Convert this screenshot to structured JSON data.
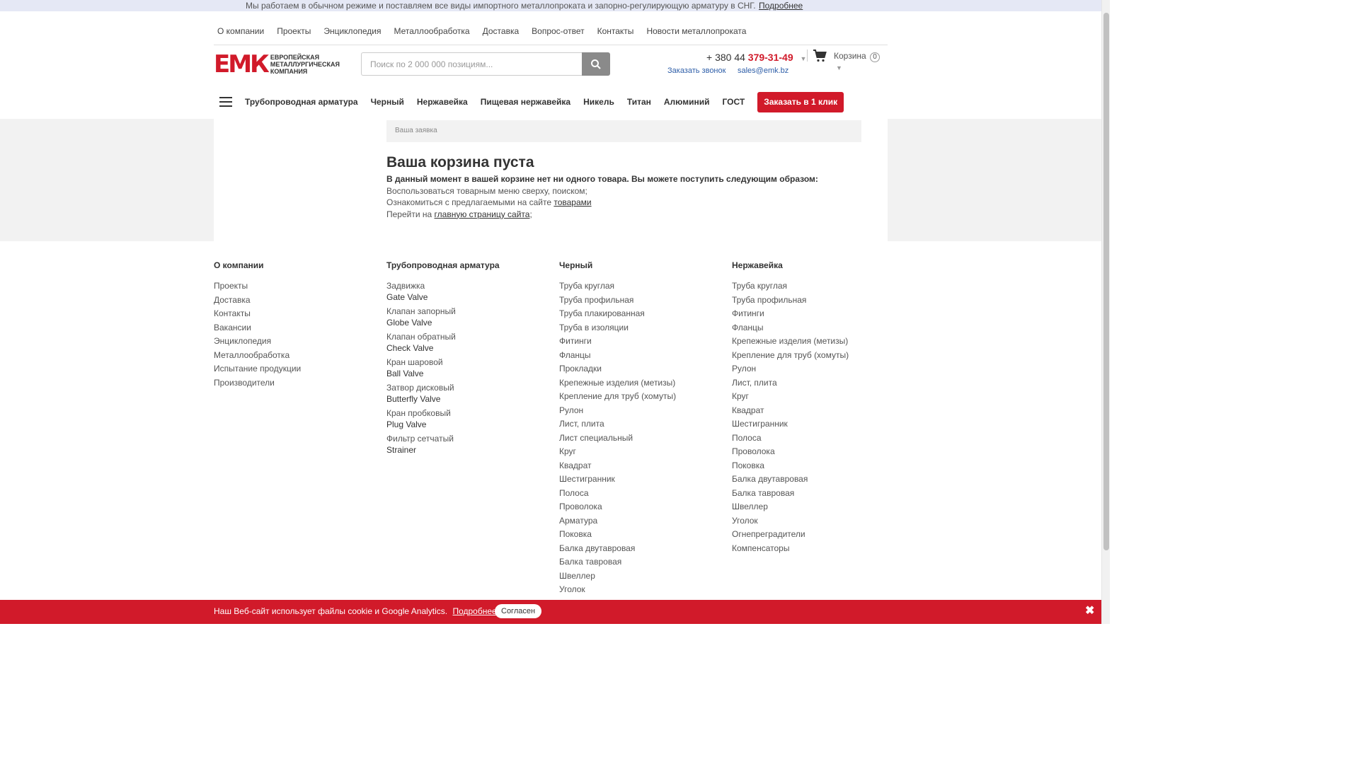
{
  "top_notice": {
    "message": "Мы работаем в обычном режиме и поставляем все виды импортного металлопроката и запорно-регулирующую арматуру в СНГ.",
    "more_link": "Подробнее"
  },
  "top_nav": [
    "О компании",
    "Проекты",
    "Энциклопедия",
    "Металлообработка",
    "Доставка",
    "Вопрос-ответ",
    "Контакты",
    "Новости металлопроката"
  ],
  "header": {
    "logo_mark": "ЕМК",
    "logo_text_1": "Европейская",
    "logo_text_2": "Металлургическая",
    "logo_text_3": "Компания",
    "search_placeholder": "Поиск по 2 000 000 позициям...",
    "phone_prefix": "+ 380 44",
    "phone_number": "379-31-49",
    "callback_link": "Заказать звонок",
    "email_link": "sales@emk.bz",
    "cart_label": "Корзина",
    "cart_count": "0"
  },
  "category_nav": {
    "items": [
      "Трубопроводная арматура",
      "Черный",
      "Нержавейка",
      "Пищевая нержавейка",
      "Никель",
      "Титан",
      "Алюминий",
      "ГОСТ"
    ],
    "order_button": "Заказать в 1 клик"
  },
  "cart_page": {
    "breadcrumb": "Ваша заявка",
    "title": "Ваша корзина пуста",
    "lead": "В данный момент в вашей корзине нет ни одного товара. Вы можете поступить следующим образом:",
    "line1": "Воспользоваться товарным меню сверху, поиском;",
    "line2_prefix": "Ознакомиться с предлагаемыми на сайте",
    "line2_link": "товарами",
    "line3_prefix": "Перейти на",
    "line3_link": "главную страницу сайта",
    "line3_suffix": ";"
  },
  "footer": {
    "col1": {
      "title": "О компании",
      "links": [
        "Проекты",
        "Доставка",
        "Контакты",
        "Вакансии",
        "Энциклопедия",
        "Металлообработка",
        "Испытание продукции",
        "Производители"
      ]
    },
    "col2": {
      "title": "Трубопроводная арматура",
      "links": [
        {
          "ru": "Задвижка",
          "en": "Gate Valve"
        },
        {
          "ru": "Клапан запорный",
          "en": "Globe Valve"
        },
        {
          "ru": "Клапан обратный",
          "en": "Check Valve"
        },
        {
          "ru": "Кран шаровой",
          "en": "Ball Valve"
        },
        {
          "ru": "Затвор дисковый",
          "en": "Butterfly Valve"
        },
        {
          "ru": "Кран пробковый",
          "en": "Plug Valve"
        },
        {
          "ru": "Фильтр сетчатый",
          "en": "Strainer"
        }
      ]
    },
    "col3": {
      "title": "Черный",
      "links": [
        "Труба круглая",
        "Труба профильная",
        "Труба плакированная",
        "Труба в изоляции",
        "Фитинги",
        "Фланцы",
        "Прокладки",
        "Крепежные изделия (метизы)",
        "Крепление для труб (хомуты)",
        "Рулон",
        "Лист, плита",
        "Лист специальный",
        "Круг",
        "Квадрат",
        "Шестигранник",
        "Полоса",
        "Проволока",
        "Арматура",
        "Поковка",
        "Балка двутавровая",
        "Балка тавровая",
        "Швеллер",
        "Уголок"
      ]
    },
    "col4": {
      "title": "Нержавейка",
      "links": [
        "Труба круглая",
        "Труба профильная",
        "Фитинги",
        "Фланцы",
        "Крепежные изделия (метизы)",
        "Крепление для труб (хомуты)",
        "Рулон",
        "Лист, плита",
        "Круг",
        "Квадрат",
        "Шестигранник",
        "Полоса",
        "Проволока",
        "Поковка",
        "Балка двутавровая",
        "Балка тавровая",
        "Швеллер",
        "Уголок",
        "Огнепреградители",
        "Компенсаторы"
      ]
    }
  },
  "cookie_bar": {
    "text": "Наш Веб-сайт использует файлы cookie и Google Analytics.",
    "more_link": "Подробнее",
    "agree_button": "Согласен",
    "close_icon": "close-icon"
  },
  "colors": {
    "brand_red": "#d11a2a",
    "link_blue": "#2e5ea8",
    "notice_bg": "#e5e8f5"
  }
}
